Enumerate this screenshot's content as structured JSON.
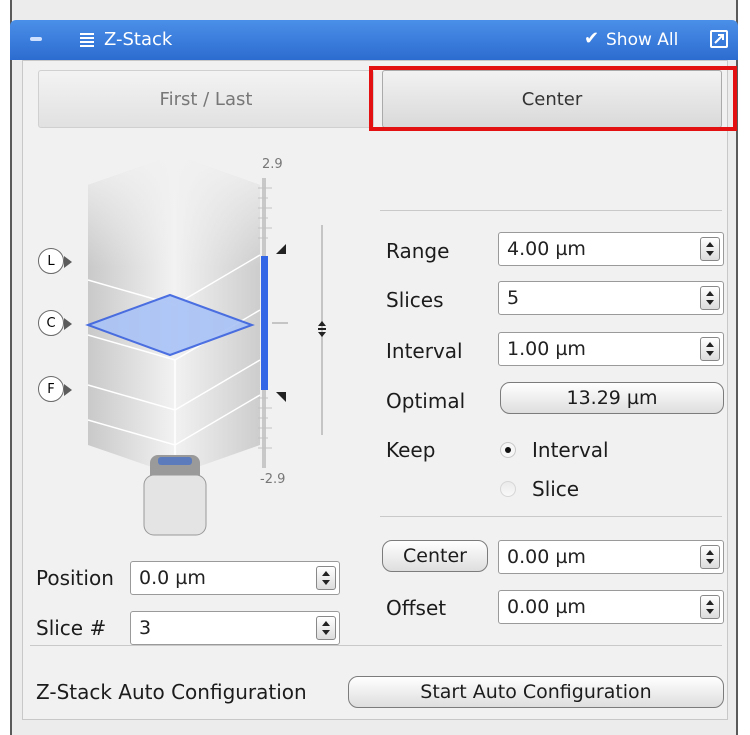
{
  "panel": {
    "title": "Z-Stack",
    "show_all_label": "Show All",
    "accent": "#2f73d8"
  },
  "mode_tabs": [
    {
      "label": "First / Last",
      "selected": false
    },
    {
      "label": "Center",
      "selected": true
    }
  ],
  "scale": {
    "top": "2.9",
    "bottom": "-2.9"
  },
  "markers": [
    {
      "label": "L"
    },
    {
      "label": "C"
    },
    {
      "label": "F"
    }
  ],
  "position": {
    "label": "Position",
    "value": "0.0 µm"
  },
  "slice_number": {
    "label": "Slice #",
    "value": "3"
  },
  "range": {
    "label": "Range",
    "value": "4.00 µm"
  },
  "slices": {
    "label": "Slices",
    "value": "5"
  },
  "interval": {
    "label": "Interval",
    "value": "1.00 µm"
  },
  "optimal": {
    "label": "Optimal",
    "value": "13.29 µm"
  },
  "keep": {
    "label": "Keep",
    "options": [
      {
        "label": "Interval",
        "selected": true
      },
      {
        "label": "Slice",
        "selected": false
      }
    ]
  },
  "center": {
    "button_label": "Center",
    "value": "0.00 µm"
  },
  "offset": {
    "label": "Offset",
    "value": "0.00 µm"
  },
  "auto_config": {
    "label": "Z-Stack Auto Configuration",
    "button_label": "Start Auto Configuration"
  },
  "highlight_color": "#e31111"
}
